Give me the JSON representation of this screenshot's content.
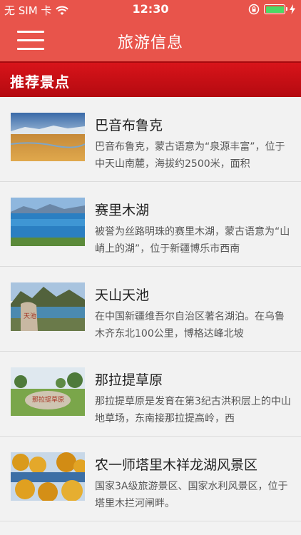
{
  "status_bar": {
    "carrier": "无 SIM 卡",
    "time": "12:30",
    "battery_level": 1.0
  },
  "nav": {
    "title": "旅游信息"
  },
  "section": {
    "title": "推荐景点"
  },
  "items": [
    {
      "title": "巴音布鲁克",
      "desc": "巴音布鲁克，蒙古语意为“泉源丰富”，位于中天山南麓，海拔约2500米，面积"
    },
    {
      "title": "赛里木湖",
      "desc": "被誉为丝路明珠的赛里木湖，蒙古语意为“山峭上的湖”，位于新疆博乐市西南"
    },
    {
      "title": "天山天池",
      "desc": "在中国新疆维吾尔自治区著名湖泊。在乌鲁木齐东北100公里，博格达峰北坡"
    },
    {
      "title": "那拉提草原",
      "desc": "那拉提草原是发育在第3纪古洪积层上的中山地草场，东南接那拉提高岭，西"
    },
    {
      "title": "农一师塔里木祥龙湖风景区",
      "desc": "国家3A级旅游景区、国家水利风景区，位于塔里木拦河闸畔。"
    }
  ]
}
